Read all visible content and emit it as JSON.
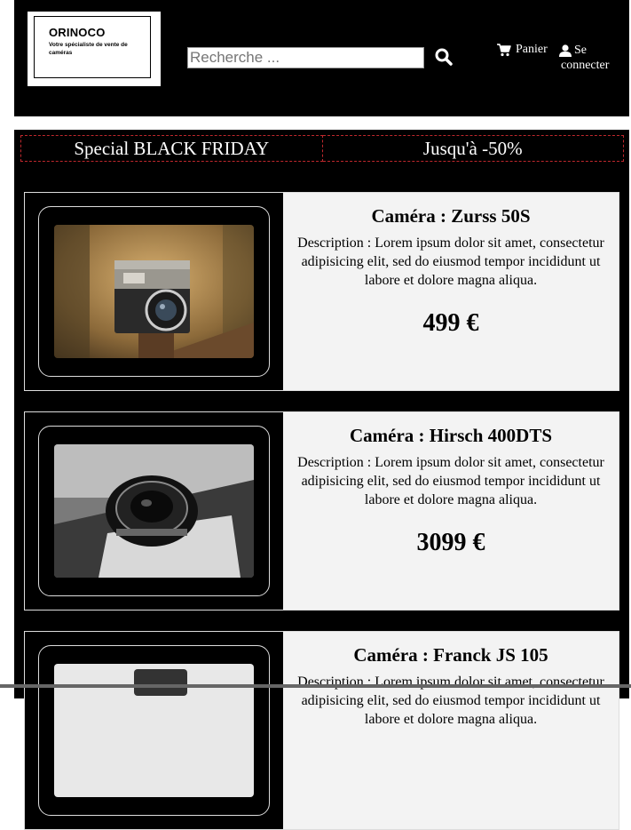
{
  "header": {
    "logo_title": "ORINOCO",
    "logo_subtitle": "Votre spécialiste de vente de caméras",
    "search_placeholder": "Recherche ...",
    "cart_label": "Panier",
    "login_line1": "Se",
    "login_line2": "connecter"
  },
  "banner": {
    "left": "Special BLACK FRIDAY",
    "right": "Jusqu'à -50%"
  },
  "products": [
    {
      "title": "Caméra : Zurss 50S",
      "description": "Description : Lorem ipsum dolor sit amet, consectetur adipisicing elit, sed do eiusmod tempor incididunt ut labore et dolore magna aliqua.",
      "price": "499 €"
    },
    {
      "title": "Caméra : Hirsch 400DTS",
      "description": "Description : Lorem ipsum dolor sit amet, consectetur adipisicing elit, sed do eiusmod tempor incididunt ut labore et dolore magna aliqua.",
      "price": "3099 €"
    },
    {
      "title": "Caméra : Franck JS 105",
      "description": "Description : Lorem ipsum dolor sit amet, consectetur adipisicing elit, sed do eiusmod tempor incididunt ut labore et dolore magna aliqua.",
      "price": ""
    }
  ],
  "colors": {
    "background": "#000000",
    "card_body": "#f3f3f3",
    "banner_border": "#c0282d"
  }
}
